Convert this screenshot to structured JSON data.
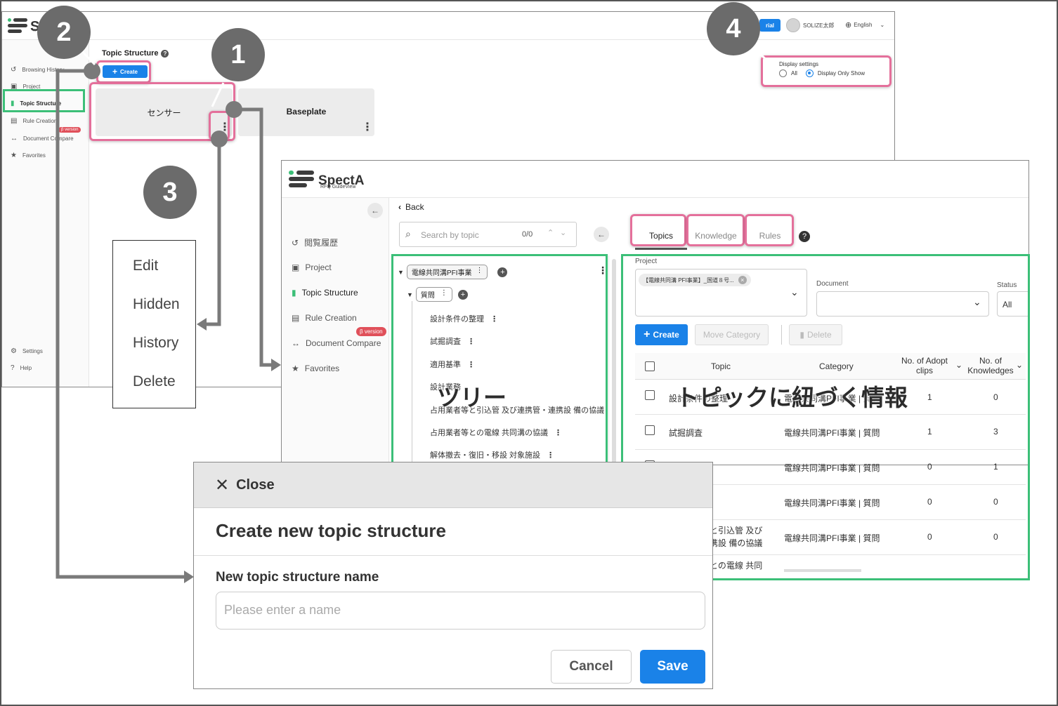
{
  "back_app": {
    "logo_partial": "S",
    "logo_sub": "R",
    "header": {
      "trial_label": "rial",
      "user_name": "SOLIZE太郎",
      "language": "English"
    },
    "nav": [
      {
        "label": "Browsing History",
        "icon": "history-icon"
      },
      {
        "label": "Project",
        "icon": "briefcase-icon"
      },
      {
        "label": "Topic Structure",
        "icon": "clipboard-icon"
      },
      {
        "label": "Rule Creation",
        "icon": "rule-icon"
      },
      {
        "label": "Document Compare",
        "icon": "compare-icon"
      },
      {
        "label": "Favorites",
        "icon": "star-icon"
      }
    ],
    "beta_badge": "β version",
    "settings_label": "Settings",
    "help_label": "Help",
    "page_title": "Topic Structure",
    "create_label": "Create",
    "cards": [
      {
        "title": "センサー"
      },
      {
        "title": "Baseplate"
      }
    ],
    "display_settings": {
      "title": "Display settings",
      "options": [
        {
          "label": "All",
          "selected": false
        },
        {
          "label": "Display Only Show",
          "selected": true
        }
      ]
    }
  },
  "context_menu": [
    "Edit",
    "Hidden",
    "History",
    "Delete"
  ],
  "badges": [
    "1",
    "2",
    "3",
    "4"
  ],
  "front_app": {
    "logo": "SpectA",
    "logo_sub": "RFQ GuideView",
    "back_label": "Back",
    "search_placeholder": "Search by topic",
    "search_count": "0/0",
    "nav": [
      {
        "label": "閲覧履歴",
        "icon": "history-icon"
      },
      {
        "label": "Project",
        "icon": "briefcase-icon"
      },
      {
        "label": "Topic Structure",
        "icon": "clipboard-icon"
      },
      {
        "label": "Rule Creation",
        "icon": "rule-icon"
      },
      {
        "label": "Document Compare",
        "icon": "compare-icon"
      },
      {
        "label": "Favorites",
        "icon": "star-icon"
      }
    ],
    "beta_badge": "β version",
    "tree": {
      "root": "電線共同溝PFI事業",
      "child": "質問",
      "items": [
        "設計条件の整理",
        "試掘調査",
        "適用基準",
        "設計業務",
        "占用業者等と引込管 及び連携管・連携設 備の協議",
        "占用業者等との電線 共同溝の協議",
        "解体撤去・復旧・移設 対象施設"
      ]
    },
    "tabs": [
      "Topics",
      "Knowledge",
      "Rules"
    ],
    "filters": {
      "project_label": "Project",
      "project_chip": "【電線共同溝 PFI事業】_国道８号...",
      "document_label": "Document",
      "status_label": "Status",
      "status_value": "All"
    },
    "actions": {
      "create": "Create",
      "move_category": "Move Category",
      "delete": "Delete"
    },
    "table": {
      "headers": [
        "Topic",
        "Category",
        "No. of Adopt clips",
        "No. of Knowledges"
      ],
      "rows": [
        {
          "topic": "設計条件の整理",
          "category": "電線共同溝PFI事業 | 質問",
          "adopt": "1",
          "knowledges": "0"
        },
        {
          "topic": "試掘調査",
          "category": "電線共同溝PFI事業 | 質問",
          "adopt": "1",
          "knowledges": "3"
        },
        {
          "topic": "",
          "category": "電線共同溝PFI事業 | 質問",
          "adopt": "0",
          "knowledges": "1"
        },
        {
          "topic": "",
          "category": "電線共同溝PFI事業 | 質問",
          "adopt": "0",
          "knowledges": "0"
        },
        {
          "topic": "と引込管 及び 携設 備の協議",
          "category": "電線共同溝PFI事業 | 質問",
          "adopt": "0",
          "knowledges": "0"
        },
        {
          "topic": "との電線 共同",
          "category": "",
          "adopt": "",
          "knowledges": ""
        }
      ]
    },
    "overlay_labels": {
      "tree": "ツリー",
      "info": "トピックに紐づく情報"
    }
  },
  "modal": {
    "close_label": "Close",
    "title": "Create new topic structure",
    "field_label": "New topic structure name",
    "placeholder": "Please enter a name",
    "cancel": "Cancel",
    "save": "Save"
  },
  "colors": {
    "pink": "#e4709b",
    "green": "#3cbf78",
    "blue": "#1a82e8",
    "badge": "#6b6b6b",
    "beta": "#e0505a"
  }
}
